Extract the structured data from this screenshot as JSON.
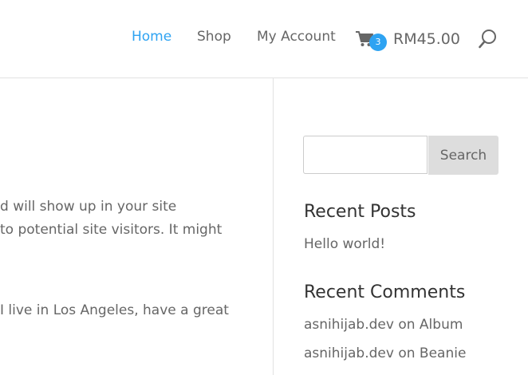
{
  "header": {
    "nav": {
      "home": "Home",
      "shop": "Shop",
      "my_account": "My Account"
    },
    "cart": {
      "icon": "cart-icon",
      "count": "3",
      "total": "RM45.00"
    },
    "search_icon": "search-icon",
    "colors": {
      "accent": "#2ea3f2",
      "text": "#666666"
    }
  },
  "content": {
    "lines": [
      "d will show up in your site",
      "to potential site visitors. It might",
      "I live in Los Angeles, have a great"
    ]
  },
  "sidebar": {
    "search": {
      "value": "",
      "button_label": "Search"
    },
    "recent_posts": {
      "title": "Recent Posts",
      "items": [
        "Hello world!"
      ]
    },
    "recent_comments": {
      "title": "Recent Comments",
      "items": [
        {
          "author": "asnihijab.dev",
          "on": "on",
          "post": "Album"
        },
        {
          "author": "asnihijab.dev",
          "on": "on",
          "post": "Beanie"
        }
      ]
    }
  }
}
